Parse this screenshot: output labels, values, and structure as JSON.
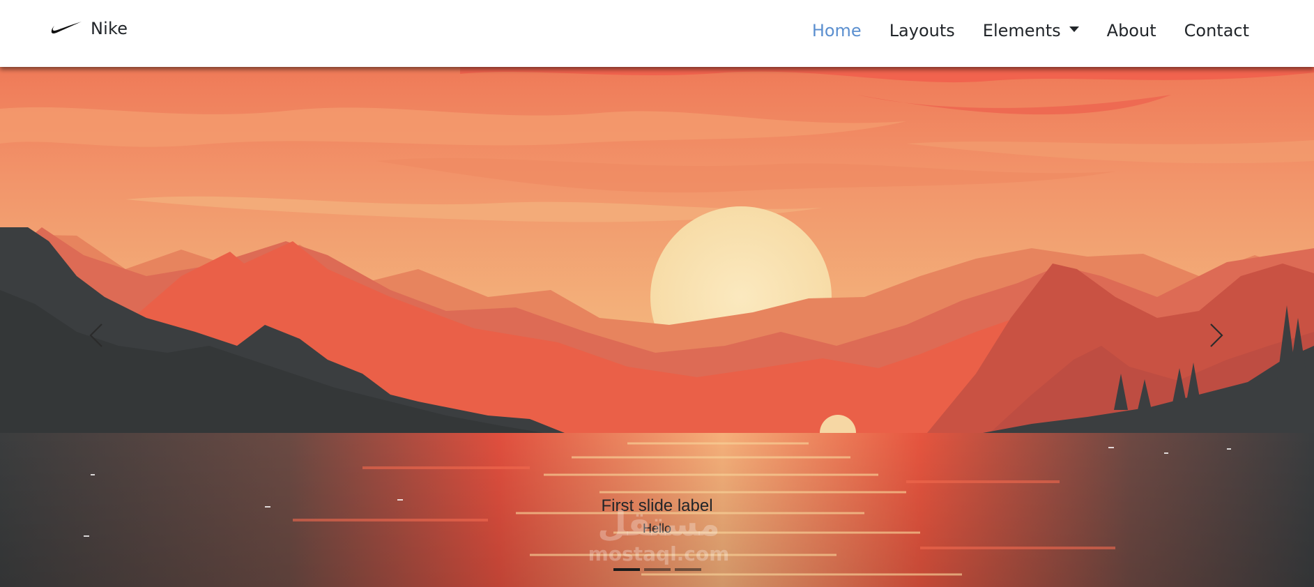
{
  "brand": {
    "name": "Nike",
    "logo_icon": "nike-swoosh-icon"
  },
  "nav": {
    "items": [
      {
        "label": "Home",
        "active": true
      },
      {
        "label": "Layouts",
        "active": false
      },
      {
        "label": "Elements",
        "active": false,
        "dropdown": true
      },
      {
        "label": "About",
        "active": false
      },
      {
        "label": "Contact",
        "active": false
      }
    ],
    "active_color": "#5b8fcf"
  },
  "carousel": {
    "prev_icon": "chevron-left-icon",
    "next_icon": "chevron-right-icon",
    "caption": {
      "title": "First slide label",
      "text": "Hello"
    },
    "slide_count": 3,
    "active_index": 0
  },
  "watermark": {
    "arabic": "مستقل",
    "latin": "mostaql.com"
  },
  "colors": {
    "sky_top": "#f06a4f",
    "sky_mid": "#f2a06c",
    "sun": "#f9e6b8",
    "mountain_dark": "#3a3d3f",
    "mountain_red": "#e8604a",
    "water": "#e2563f"
  }
}
